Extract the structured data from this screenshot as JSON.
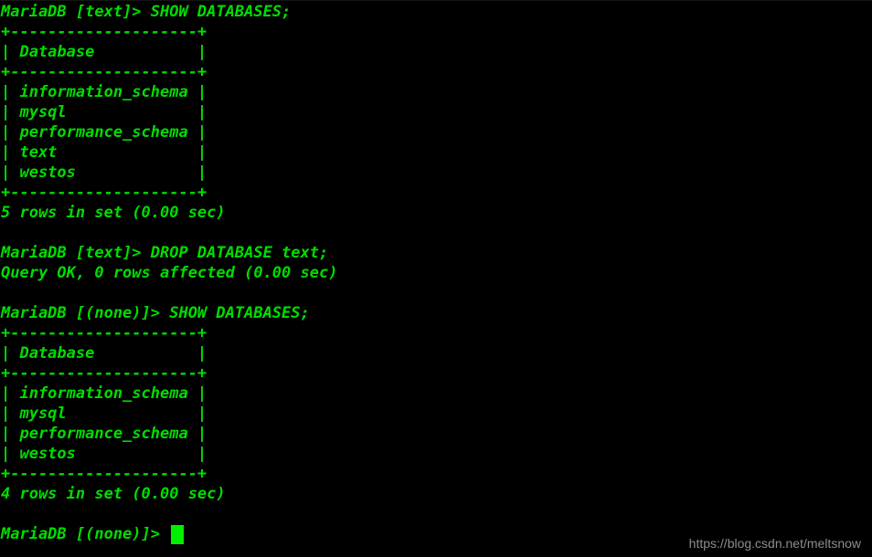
{
  "terminal": {
    "title": "MariaDB client session",
    "colors": {
      "background": "#000000",
      "foreground": "#00dd00",
      "cursor": "#00f000",
      "watermark": "#8d8d8d"
    },
    "cursor": {
      "shape": "block",
      "visible": true
    },
    "lines": [
      {
        "id": "l01",
        "kind": "prompt",
        "text": "MariaDB [text]> SHOW DATABASES;"
      },
      {
        "id": "l02",
        "kind": "border",
        "text": "+--------------------+"
      },
      {
        "id": "l03",
        "kind": "header",
        "text": "| Database           |"
      },
      {
        "id": "l04",
        "kind": "border",
        "text": "+--------------------+"
      },
      {
        "id": "l05",
        "kind": "row",
        "text": "| information_schema |"
      },
      {
        "id": "l06",
        "kind": "row",
        "text": "| mysql              |"
      },
      {
        "id": "l07",
        "kind": "row",
        "text": "| performance_schema |"
      },
      {
        "id": "l08",
        "kind": "row",
        "text": "| text               |"
      },
      {
        "id": "l09",
        "kind": "row",
        "text": "| westos             |"
      },
      {
        "id": "l10",
        "kind": "border",
        "text": "+--------------------+"
      },
      {
        "id": "l11",
        "kind": "status",
        "text": "5 rows in set (0.00 sec)"
      },
      {
        "id": "l12",
        "kind": "blank",
        "text": " "
      },
      {
        "id": "l13",
        "kind": "prompt",
        "text": "MariaDB [text]> DROP DATABASE text;"
      },
      {
        "id": "l14",
        "kind": "status",
        "text": "Query OK, 0 rows affected (0.00 sec)"
      },
      {
        "id": "l15",
        "kind": "blank",
        "text": " "
      },
      {
        "id": "l16",
        "kind": "prompt",
        "text": "MariaDB [(none)]> SHOW DATABASES;"
      },
      {
        "id": "l17",
        "kind": "border",
        "text": "+--------------------+"
      },
      {
        "id": "l18",
        "kind": "header",
        "text": "| Database           |"
      },
      {
        "id": "l19",
        "kind": "border",
        "text": "+--------------------+"
      },
      {
        "id": "l20",
        "kind": "row",
        "text": "| information_schema |"
      },
      {
        "id": "l21",
        "kind": "row",
        "text": "| mysql              |"
      },
      {
        "id": "l22",
        "kind": "row",
        "text": "| performance_schema |"
      },
      {
        "id": "l23",
        "kind": "row",
        "text": "| westos             |"
      },
      {
        "id": "l24",
        "kind": "border",
        "text": "+--------------------+"
      },
      {
        "id": "l25",
        "kind": "status",
        "text": "4 rows in set (0.00 sec)"
      },
      {
        "id": "l26",
        "kind": "blank",
        "text": " "
      }
    ],
    "current_prompt": "MariaDB [(none)]> ",
    "input_value": ""
  },
  "watermark": {
    "text": "https://blog.csdn.net/meltsnow"
  }
}
